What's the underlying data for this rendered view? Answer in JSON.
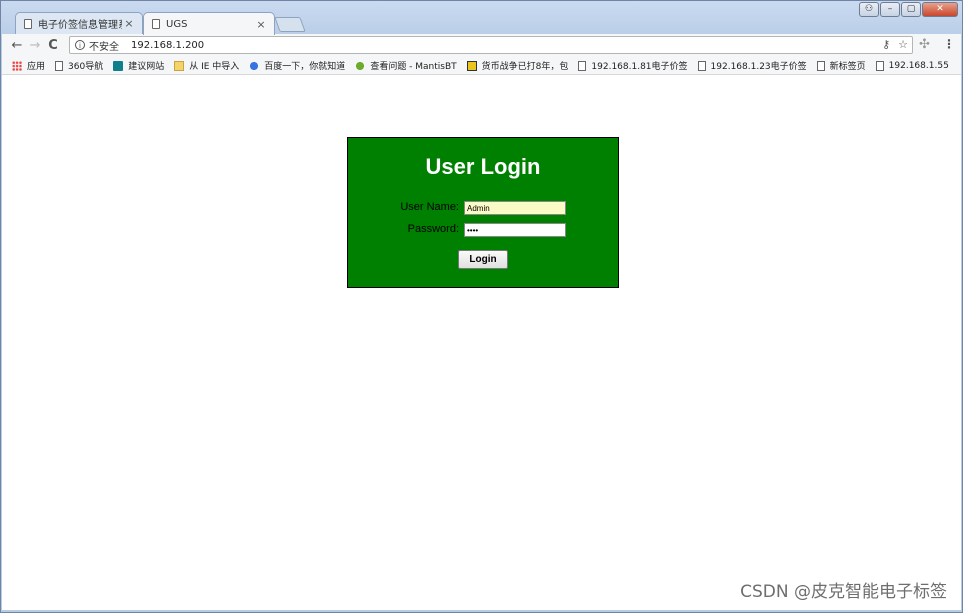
{
  "browser": {
    "tabs": [
      {
        "title": "电子价签信息管理系统",
        "close": "×",
        "active": false
      },
      {
        "title": "UGS",
        "close": "×",
        "active": true
      }
    ],
    "window_controls": {
      "user": "⚇",
      "minimize": "–",
      "maximize": "▢",
      "close": "✕"
    },
    "nav": {
      "back": "←",
      "forward": "→",
      "reload": "C"
    },
    "address": {
      "info": "i",
      "security_label": "不安全",
      "url": "192.168.1.200",
      "key_icon": "⚷",
      "star_icon": "☆"
    },
    "extension_icon": "✣",
    "menu_icon": "⋮",
    "bookmarks": [
      {
        "icon": "apps-grid-icon",
        "label": "应用"
      },
      {
        "icon": "page-icon",
        "label": "360导航"
      },
      {
        "icon": "bing-icon",
        "label": "建议网站"
      },
      {
        "icon": "folder-icon",
        "label": "从 IE 中导入"
      },
      {
        "icon": "baidu-paw-icon",
        "label": "百度一下，你就知道"
      },
      {
        "icon": "mantis-icon",
        "label": "查看问题 - MantisBT"
      },
      {
        "icon": "coin-icon",
        "label": "货币战争已打8年，包"
      },
      {
        "icon": "page-icon",
        "label": "192.168.1.81电子价签"
      },
      {
        "icon": "page-icon",
        "label": "192.168.1.23电子价签"
      },
      {
        "icon": "page-icon",
        "label": "新标签页"
      },
      {
        "icon": "page-icon",
        "label": "192.168.1.55"
      }
    ]
  },
  "login": {
    "title": "User Login",
    "username_label": "User Name:",
    "username_value": "Admin",
    "password_label": "Password:",
    "password_value": "••••",
    "button_label": "Login",
    "box_color": "#008000"
  },
  "watermark": "CSDN @皮克智能电子标签"
}
